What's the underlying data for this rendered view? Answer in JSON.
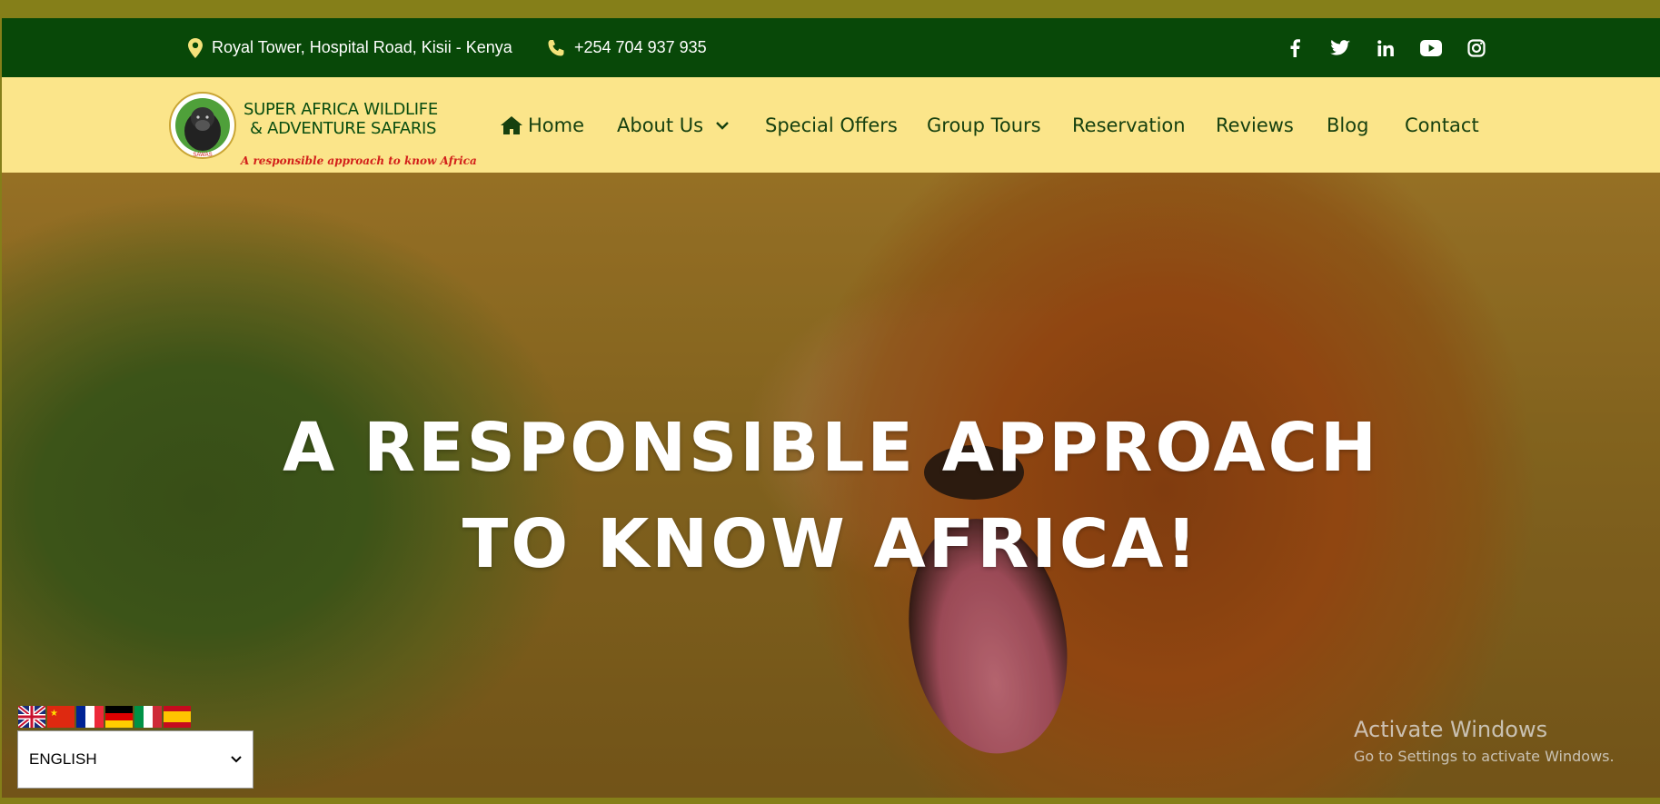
{
  "topbar": {
    "address": "Royal Tower, Hospital Road, Kisii - Kenya",
    "phone": "+254 704 937 935",
    "social": [
      "facebook-icon",
      "twitter-icon",
      "linkedin-icon",
      "youtube-icon",
      "instagram-icon"
    ]
  },
  "logo": {
    "line1": "SUPER AFRICA WILDLIFE",
    "line2": "& ADVENTURE SAFARIS",
    "tagline": "A responsible approach to know Africa"
  },
  "nav": {
    "home": "Home",
    "about": "About Us",
    "offers": "Special Offers",
    "group": "Group Tours",
    "reservation": "Reservation",
    "reviews": "Reviews",
    "blog": "Blog",
    "contact": "Contact"
  },
  "hero": {
    "line1": "A RESPONSIBLE APPROACH",
    "line2": "TO KNOW AFRICA!"
  },
  "language": {
    "flags": [
      "en-flag",
      "cn-flag",
      "fr-flag",
      "de-flag",
      "it-flag",
      "es-flag"
    ],
    "selected": "ENGLISH"
  },
  "watermark": {
    "title": "Activate Windows",
    "subtitle": "Go to Settings to activate Windows."
  },
  "colors": {
    "topbar": "#084808",
    "navbar": "#fbe58a",
    "nav_text": "#16400f",
    "accent_icon": "#f4e27a"
  }
}
